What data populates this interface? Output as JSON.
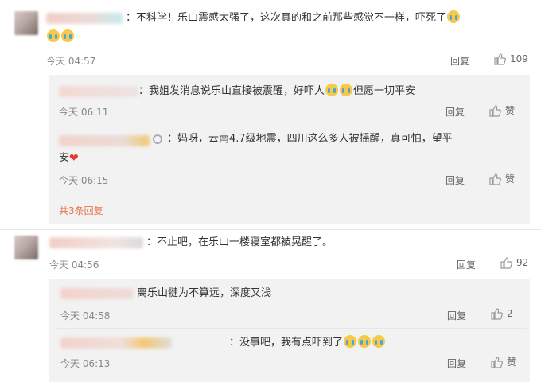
{
  "comments": [
    {
      "text_pre": "：不科学！乐山震感太强了，这次真的和之前那些感觉不一样，吓死了",
      "time": "今天 04:57",
      "reply_label": "回复",
      "like_count": "109",
      "replies": [
        {
          "text_pre": "：我姐发消息说乐山直接被震醒，好吓人",
          "text_post": "但愿一切平安",
          "time": "今天 06:11",
          "reply_label": "回复",
          "like_label": "赞"
        },
        {
          "text_line1": "：妈呀，云南4.7级地震，四川这么多人被摇醒，真可怕，望平",
          "text_line2": "安",
          "time": "今天 06:15",
          "reply_label": "回复",
          "like_label": "赞"
        }
      ],
      "more_replies": "共3条回复"
    },
    {
      "text": "：不止吧，在乐山一楼寝室都被晃醒了。",
      "time": "今天 04:56",
      "reply_label": "回复",
      "like_count": "92",
      "replies": [
        {
          "text": "离乐山犍为不算远，深度又浅",
          "time": "今天 04:58",
          "reply_label": "回复",
          "like_count": "2"
        },
        {
          "text": "：没事吧，我有点吓到了",
          "time": "今天 06:13",
          "reply_label": "回复",
          "like_label": "赞"
        }
      ]
    }
  ],
  "icons": {
    "like": "thumbs-up-icon",
    "cry": "crying-emoji-icon",
    "heart": "red-heart-icon"
  },
  "colors": {
    "link": "#eb7350",
    "reply_bg": "#f2f2f2"
  }
}
